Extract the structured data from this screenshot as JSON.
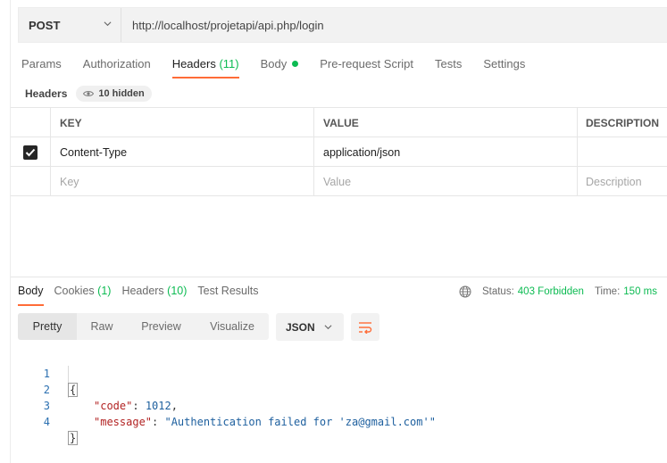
{
  "request": {
    "method": "POST",
    "url": "http://localhost/projetapi/api.php/login"
  },
  "request_tabs": [
    {
      "label": "Params"
    },
    {
      "label": "Authorization"
    },
    {
      "label": "Headers",
      "count": "(11)",
      "active": true
    },
    {
      "label": "Body",
      "has_dot": true
    },
    {
      "label": "Pre-request Script"
    },
    {
      "label": "Tests"
    },
    {
      "label": "Settings"
    }
  ],
  "headers_section": {
    "label": "Headers",
    "hidden_text": "10 hidden"
  },
  "headers_table": {
    "columns": [
      "KEY",
      "VALUE",
      "DESCRIPTION"
    ],
    "rows": [
      {
        "checked": true,
        "key": "Content-Type",
        "value": "application/json",
        "description": ""
      }
    ],
    "placeholder": {
      "key": "Key",
      "value": "Value",
      "description": "Description"
    }
  },
  "response_tabs": [
    {
      "label": "Body",
      "active": true
    },
    {
      "label": "Cookies",
      "count": "(1)"
    },
    {
      "label": "Headers",
      "count": "(10)"
    },
    {
      "label": "Test Results"
    }
  ],
  "status": {
    "status_label": "Status:",
    "status_value": "403 Forbidden",
    "time_label": "Time:",
    "time_value": "150 ms"
  },
  "viewer": {
    "modes": [
      "Pretty",
      "Raw",
      "Preview",
      "Visualize"
    ],
    "active_mode": "Pretty",
    "language": "JSON"
  },
  "response_body": {
    "line_numbers": [
      "1",
      "2",
      "3",
      "4"
    ],
    "open_brace": "{",
    "close_brace": "}",
    "code_key": "\"code\"",
    "code_value": "1012",
    "message_key": "\"message\"",
    "message_value": "\"Authentication failed for 'za@gmail.com'\""
  },
  "colors": {
    "accent": "#ff6c37",
    "success": "#0cbb52"
  }
}
